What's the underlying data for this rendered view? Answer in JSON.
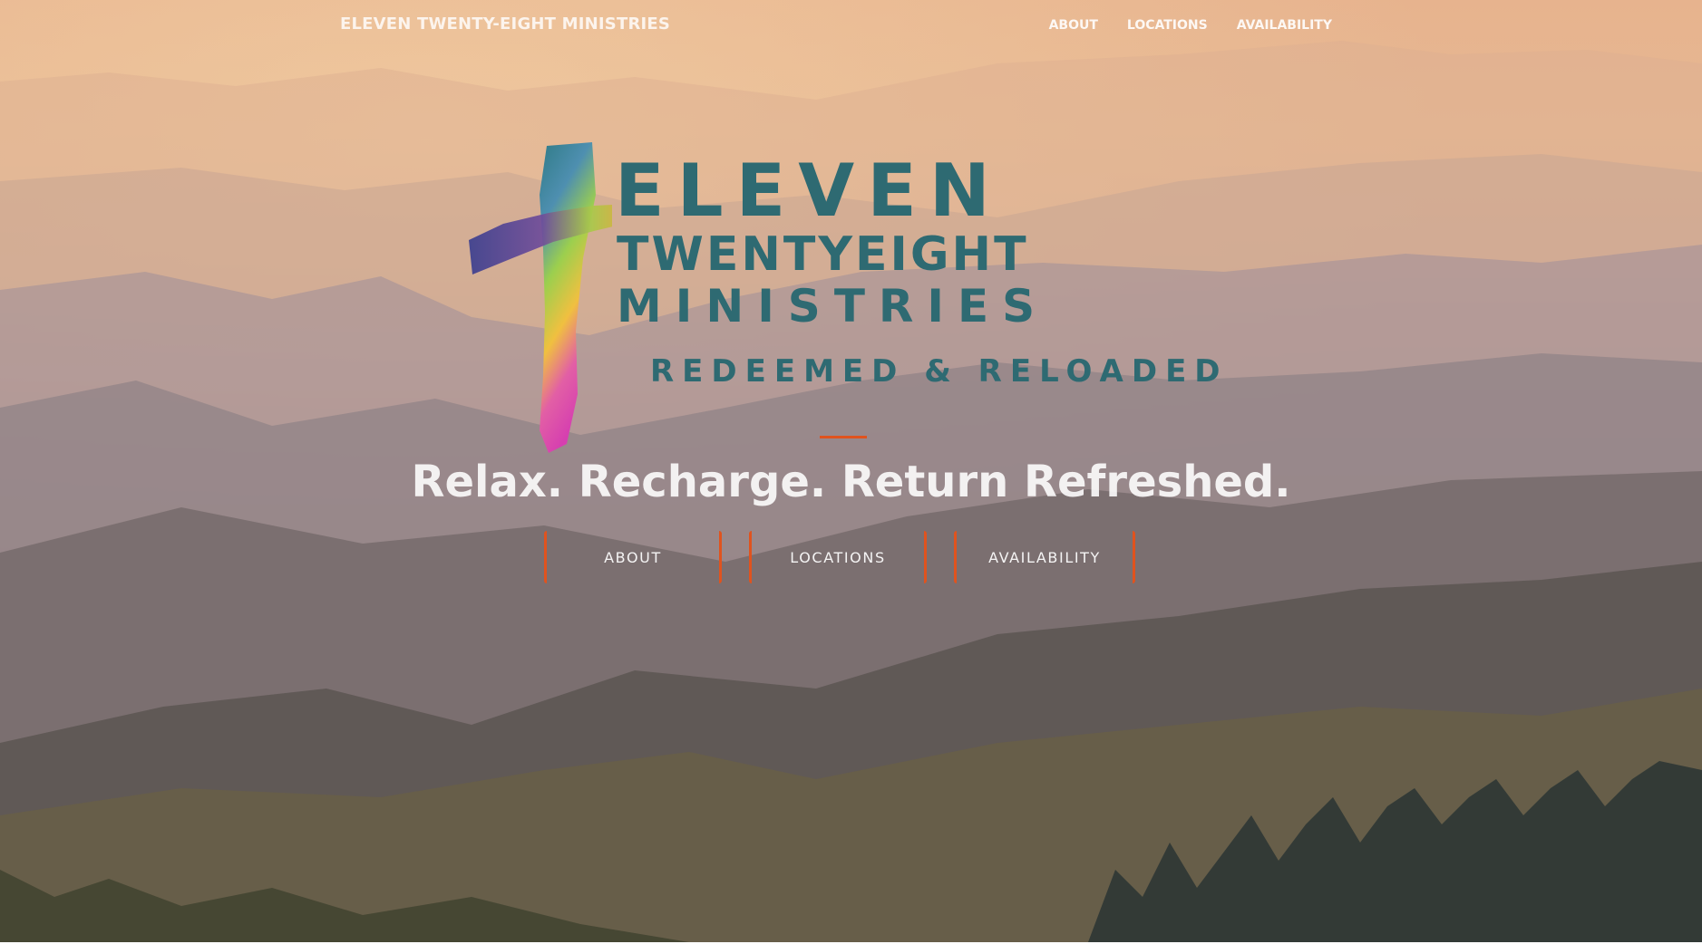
{
  "header": {
    "brand": "ELEVEN TWENTY-EIGHT MINISTRIES",
    "nav": [
      "ABOUT",
      "LOCATIONS",
      "AVAILABILITY"
    ]
  },
  "logo": {
    "line1": "ELEVEN",
    "line2": "TWENTYEIGHT",
    "line3": "MINISTRIES",
    "line4": "REDEEMED & RELOADED"
  },
  "hero": {
    "tagline": "Relax. Recharge. Return Refreshed."
  },
  "buttons": [
    "ABOUT",
    "LOCATIONS",
    "AVAILABILITY"
  ],
  "colors": {
    "accent": "#e0531e",
    "logo_teal": "#2e6a72"
  }
}
